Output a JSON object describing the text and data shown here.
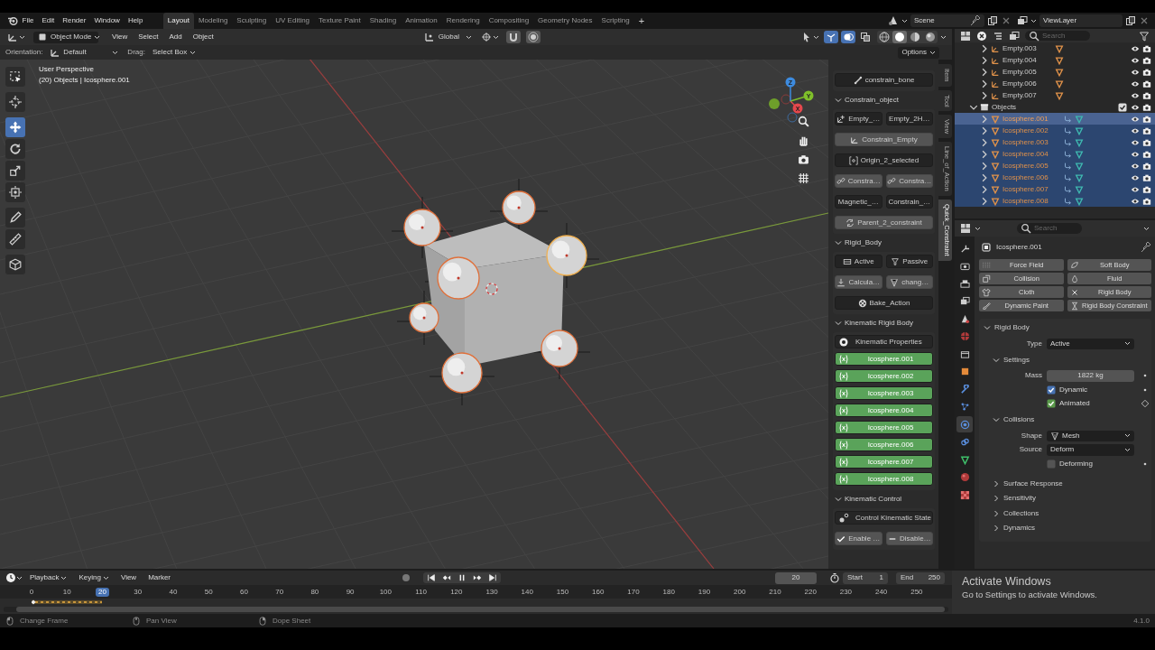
{
  "top_bar": {
    "menus": [
      "File",
      "Edit",
      "Render",
      "Window",
      "Help"
    ],
    "workspaces": [
      {
        "label": "Layout",
        "selected": true
      },
      {
        "label": "Modeling",
        "selected": false
      },
      {
        "label": "Sculpting",
        "selected": false
      },
      {
        "label": "UV Editing",
        "selected": false
      },
      {
        "label": "Texture Paint",
        "selected": false
      },
      {
        "label": "Shading",
        "selected": false
      },
      {
        "label": "Animation",
        "selected": false
      },
      {
        "label": "Rendering",
        "selected": false
      },
      {
        "label": "Compositing",
        "selected": false
      },
      {
        "label": "Geometry Nodes",
        "selected": false
      },
      {
        "label": "Scripting",
        "selected": false
      }
    ],
    "add_workspace": "+",
    "scene": "Scene",
    "view_layer": "ViewLayer"
  },
  "viewport_header": {
    "mode": "Object Mode",
    "menus": [
      "View",
      "Select",
      "Add",
      "Object"
    ],
    "transform_orientation": "Global",
    "toggles": [
      {
        "kind": "gizmo",
        "on": true
      },
      {
        "kind": "overlay",
        "on": true
      },
      {
        "kind": "xray",
        "on": false
      }
    ],
    "shading": [
      {
        "kind": "wireframe",
        "selected": false
      },
      {
        "kind": "solid",
        "selected": true
      },
      {
        "kind": "material",
        "selected": false
      },
      {
        "kind": "rendered",
        "selected": false
      }
    ]
  },
  "tool_settings": {
    "orientation_label": "Orientation:",
    "orientation": "Default",
    "drag_label": "Drag:",
    "drag": "Select Box",
    "options": "Options"
  },
  "toolbar": [
    {
      "kind": "select",
      "selected": false
    },
    {
      "kind": "cursor",
      "selected": false
    },
    {
      "kind": "move",
      "selected": true
    },
    {
      "kind": "rotate",
      "selected": false
    },
    {
      "kind": "scale",
      "selected": false
    },
    {
      "kind": "transform",
      "selected": false
    },
    {
      "kind": "annotate",
      "selected": false
    },
    {
      "kind": "measure",
      "selected": false
    },
    {
      "kind": "add_cube",
      "selected": false
    }
  ],
  "viewport": {
    "view_name": "User Perspective",
    "object_info": "(20) Objects | Icosphere.001",
    "gizmo_axes": [
      "X",
      "Y",
      "Z"
    ]
  },
  "sidebar": {
    "tabs": [
      {
        "label": "Item",
        "selected": false
      },
      {
        "label": "Tool",
        "selected": false
      },
      {
        "label": "View",
        "selected": false
      },
      {
        "label": "Line_of_Action",
        "selected": false
      },
      {
        "label": "Quick_Constraint",
        "selected": true
      }
    ],
    "sections": [
      {
        "rows": [
          [
            {
              "kind": "button",
              "label": "constrain_bone",
              "highlighted": false
            }
          ]
        ]
      },
      {
        "title": "Constrain_object",
        "expanded": true,
        "rows": [
          [
            {
              "kind": "button",
              "label": "Empty_…",
              "highlighted": false
            },
            {
              "kind": "button",
              "label": "Empty_2H…",
              "highlighted": false
            }
          ],
          [
            {
              "kind": "button",
              "label": "Constrain_Empty",
              "highlighted": true
            }
          ],
          [
            {
              "kind": "button",
              "label": "Origin_2_selected",
              "highlighted": false
            }
          ],
          [
            {
              "kind": "button",
              "label": "Constra…",
              "highlighted": true
            },
            {
              "kind": "button",
              "label": "Constra…",
              "highlighted": true
            }
          ],
          [
            {
              "kind": "button",
              "label": "Magnetic_…",
              "highlighted": false
            },
            {
              "kind": "button",
              "label": "Constrain_…",
              "highlighted": false
            }
          ],
          [
            {
              "kind": "button",
              "label": "Parent_2_constraint",
              "highlighted": true
            }
          ]
        ]
      },
      {
        "title": "Rigid_Body",
        "expanded": true,
        "rows": [
          [
            {
              "kind": "button",
              "label": "Active",
              "highlighted": false
            },
            {
              "kind": "button",
              "label": "Passive",
              "highlighted": false
            }
          ],
          [
            {
              "kind": "button",
              "label": "Calcula…",
              "highlighted": true
            },
            {
              "kind": "button",
              "label": "chang…",
              "highlighted": true
            }
          ],
          [
            {
              "kind": "button",
              "label": "Bake_Action",
              "highlighted": false
            }
          ]
        ]
      },
      {
        "title": "Kinematic Rigid Body",
        "expanded": true,
        "rows": [
          [
            {
              "kind": "label",
              "label": "Kinematic Properties"
            }
          ],
          [
            {
              "kind": "toggle",
              "label": "Icosphere.001",
              "on": true
            }
          ],
          [
            {
              "kind": "toggle",
              "label": "Icosphere.002",
              "on": true
            }
          ],
          [
            {
              "kind": "toggle",
              "label": "Icosphere.003",
              "on": true
            }
          ],
          [
            {
              "kind": "toggle",
              "label": "Icosphere.004",
              "on": true
            }
          ],
          [
            {
              "kind": "toggle",
              "label": "Icosphere.005",
              "on": true
            }
          ],
          [
            {
              "kind": "toggle",
              "label": "Icosphere.006",
              "on": true
            }
          ],
          [
            {
              "kind": "toggle",
              "label": "Icosphere.007",
              "on": true
            }
          ],
          [
            {
              "kind": "toggle",
              "label": "Icosphere.008",
              "on": true
            }
          ]
        ]
      },
      {
        "title": "Kinematic Control",
        "expanded": true,
        "rows": [
          [
            {
              "kind": "label",
              "label": "Control Kinematic State"
            }
          ],
          [
            {
              "kind": "button",
              "label": "Enable …",
              "highlighted": true
            },
            {
              "kind": "button",
              "label": "Disable…",
              "highlighted": true
            }
          ]
        ]
      }
    ]
  },
  "outliner": {
    "search_placeholder": "Search",
    "items": [
      {
        "kind": "empty",
        "name": "Empty.003",
        "selected": false
      },
      {
        "kind": "empty",
        "name": "Empty.004",
        "selected": false
      },
      {
        "kind": "empty",
        "name": "Empty.005",
        "selected": false
      },
      {
        "kind": "empty",
        "name": "Empty.006",
        "selected": false
      },
      {
        "kind": "empty",
        "name": "Empty.007",
        "selected": false
      },
      {
        "kind": "collection",
        "name": "Objects",
        "expanded": true,
        "checked": true,
        "children": [
          {
            "kind": "mesh",
            "name": "Icosphere.001",
            "selected": true,
            "active": true
          },
          {
            "kind": "mesh",
            "name": "Icosphere.002",
            "selected": true,
            "active": false
          },
          {
            "kind": "mesh",
            "name": "Icosphere.003",
            "selected": true,
            "active": false
          },
          {
            "kind": "mesh",
            "name": "Icosphere.004",
            "selected": true,
            "active": false
          },
          {
            "kind": "mesh",
            "name": "Icosphere.005",
            "selected": true,
            "active": false
          },
          {
            "kind": "mesh",
            "name": "Icosphere.006",
            "selected": true,
            "active": false
          },
          {
            "kind": "mesh",
            "name": "Icosphere.007",
            "selected": true,
            "active": false
          },
          {
            "kind": "mesh",
            "name": "Icosphere.008",
            "selected": true,
            "active": false
          }
        ]
      }
    ]
  },
  "properties": {
    "search_placeholder": "Search",
    "tabs": [
      {
        "kind": "tool",
        "selected": false
      },
      {
        "kind": "render",
        "selected": false
      },
      {
        "kind": "output",
        "selected": false
      },
      {
        "kind": "view_layer",
        "selected": false
      },
      {
        "kind": "scene",
        "selected": false
      },
      {
        "kind": "world",
        "selected": false
      },
      {
        "kind": "collection",
        "selected": false
      },
      {
        "kind": "object",
        "selected": false
      },
      {
        "kind": "modifiers",
        "selected": false
      },
      {
        "kind": "particles",
        "selected": false
      },
      {
        "kind": "physics",
        "selected": true
      },
      {
        "kind": "constraints",
        "selected": false
      },
      {
        "kind": "data",
        "selected": false
      },
      {
        "kind": "material",
        "selected": false
      },
      {
        "kind": "texture",
        "selected": false
      }
    ],
    "object_name": "Icosphere.001",
    "physics_buttons": [
      {
        "label": "Force Field",
        "enabled": false
      },
      {
        "label": "Soft Body",
        "enabled": false
      },
      {
        "label": "Collision",
        "enabled": false
      },
      {
        "label": "Fluid",
        "enabled": false
      },
      {
        "label": "Cloth",
        "enabled": false
      },
      {
        "label": "Rigid Body",
        "enabled": true
      },
      {
        "label": "Dynamic Paint",
        "enabled": false
      },
      {
        "label": "Rigid Body Constraint",
        "enabled": false
      }
    ],
    "rigid_body": {
      "title": "Rigid Body",
      "expanded": true,
      "type_label": "Type",
      "type": "Active",
      "settings": {
        "title": "Settings",
        "expanded": true,
        "mass_label": "Mass",
        "mass": "1822 kg",
        "dynamic": {
          "label": "Dynamic",
          "checked": true
        },
        "animated": {
          "label": "Animated",
          "checked": true,
          "keyed": true
        }
      },
      "collisions": {
        "title": "Collisions",
        "expanded": true,
        "shape_label": "Shape",
        "shape": "Mesh",
        "source_label": "Source",
        "source": "Deform",
        "deforming": {
          "label": "Deforming",
          "checked": false
        }
      },
      "subpanels": [
        {
          "title": "Surface Response",
          "expanded": false
        },
        {
          "title": "Sensitivity",
          "expanded": false
        },
        {
          "title": "Collections",
          "expanded": false
        },
        {
          "title": "Dynamics",
          "expanded": false
        }
      ]
    }
  },
  "timeline": {
    "menus": [
      "Playback",
      "Keying",
      "View",
      "Marker"
    ],
    "current_frame": "20",
    "start_label": "Start",
    "start": "1",
    "end_label": "End",
    "end": "250",
    "ruler": [
      {
        "label": "0",
        "selected": false
      },
      {
        "label": "10",
        "selected": false
      },
      {
        "label": "20",
        "selected": true
      },
      {
        "label": "30",
        "selected": false
      },
      {
        "label": "40",
        "selected": false
      },
      {
        "label": "50",
        "selected": false
      },
      {
        "label": "60",
        "selected": false
      },
      {
        "label": "70",
        "selected": false
      },
      {
        "label": "80",
        "selected": false
      },
      {
        "label": "90",
        "selected": false
      },
      {
        "label": "100",
        "selected": false
      },
      {
        "label": "110",
        "selected": false
      },
      {
        "label": "120",
        "selected": false
      },
      {
        "label": "130",
        "selected": false
      },
      {
        "label": "140",
        "selected": false
      },
      {
        "label": "150",
        "selected": false
      },
      {
        "label": "160",
        "selected": false
      },
      {
        "label": "170",
        "selected": false
      },
      {
        "label": "180",
        "selected": false
      },
      {
        "label": "190",
        "selected": false
      },
      {
        "label": "200",
        "selected": false
      },
      {
        "label": "210",
        "selected": false
      },
      {
        "label": "220",
        "selected": false
      },
      {
        "label": "230",
        "selected": false
      },
      {
        "label": "240",
        "selected": false
      },
      {
        "label": "250",
        "selected": false
      }
    ]
  },
  "activation_notice": {
    "title": "Activate Windows",
    "text": "Go to Settings to activate Windows."
  },
  "status_bar": {
    "hints": [
      {
        "kind": "left_click",
        "label": "Change Frame"
      },
      {
        "kind": "middle_click",
        "label": "Pan View"
      },
      {
        "kind": "right_click",
        "label": "Dope Sheet"
      }
    ],
    "version": "4.1.0"
  }
}
